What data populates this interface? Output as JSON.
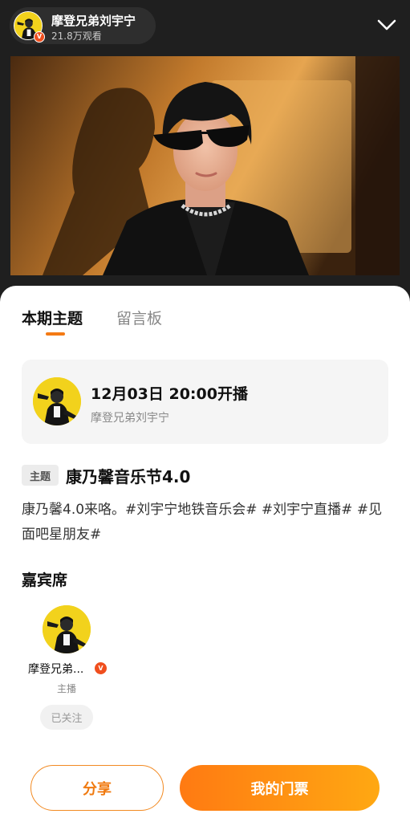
{
  "header": {
    "host_name": "摩登兄弟刘宇宁",
    "viewers": "21.8万观看",
    "verified_mark": "V",
    "collapse_icon": "chevron-down-icon"
  },
  "cover": {
    "description_icon": "live-cover-image"
  },
  "tabs": [
    {
      "label": "本期主题",
      "active": true
    },
    {
      "label": "留言板",
      "active": false
    }
  ],
  "schedule": {
    "time": "12月03日  20:00开播",
    "host": "摩登兄弟刘宇宁"
  },
  "topic": {
    "tag": "主题",
    "title": "康乃馨音乐节4.0",
    "description": "康乃馨4.0来咯。#刘宇宁地铁音乐会# #刘宇宁直播# #见面吧星朋友#"
  },
  "guests": {
    "heading": "嘉宾席",
    "items": [
      {
        "name": "摩登兄弟...",
        "role": "主播",
        "follow_label": "已关注",
        "verified_mark": "V"
      }
    ]
  },
  "actions": {
    "share_label": "分享",
    "ticket_label": "我的门票"
  },
  "colors": {
    "accent": "#f47a14",
    "ticket_gradient_start": "#ff7a12",
    "ticket_gradient_end": "#ffa812",
    "verified": "#f04f1e",
    "header_bg": "#1f1f1f"
  }
}
